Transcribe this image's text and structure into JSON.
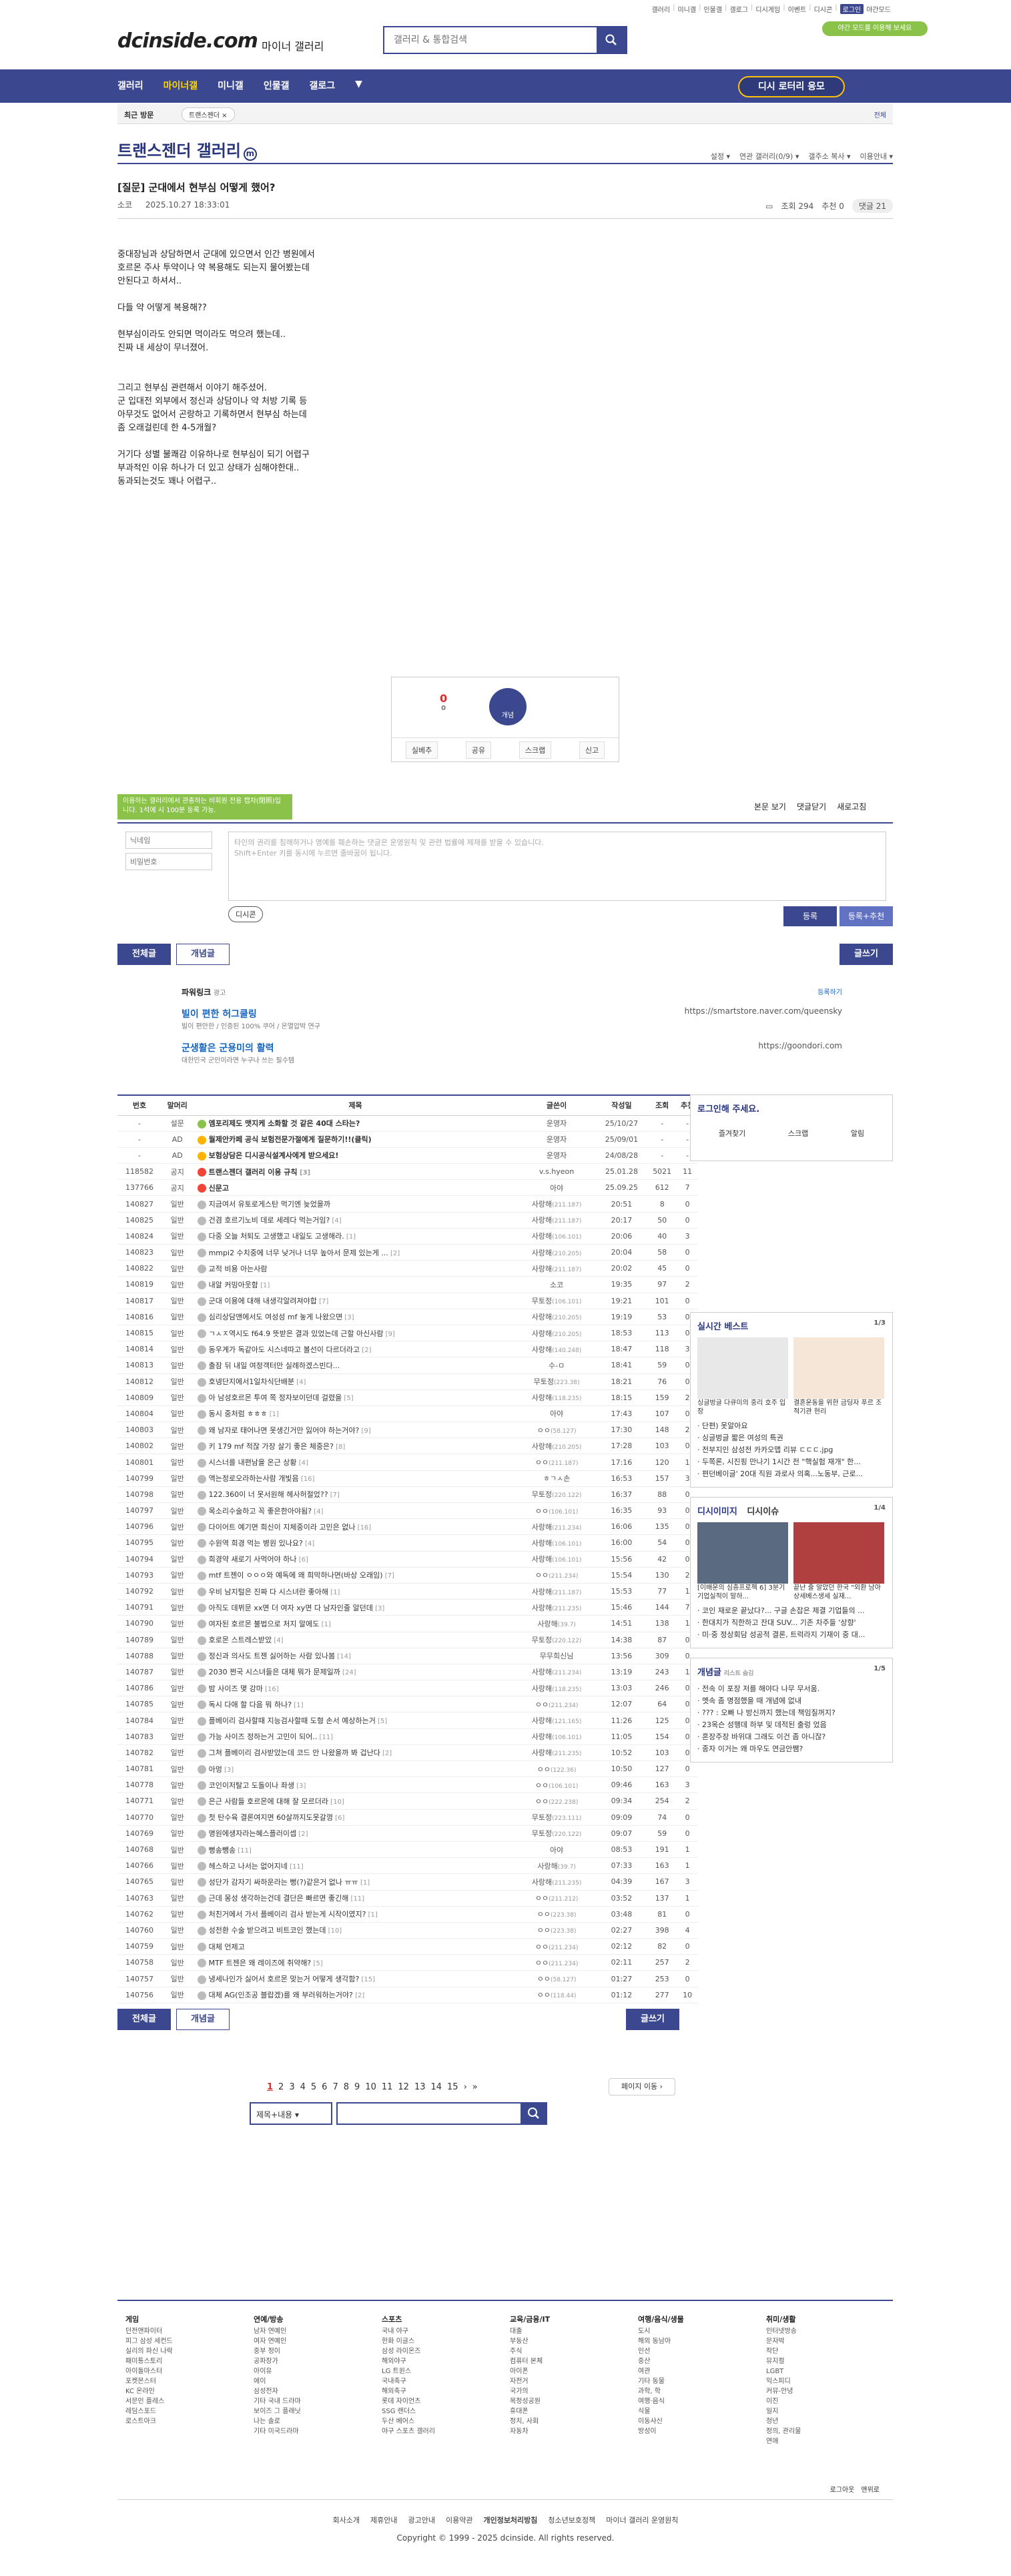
{
  "topbar": {
    "links": [
      "갤러리",
      "미니갤",
      "인물갤",
      "갤로그",
      "디시게임",
      "이벤트",
      "디시콘"
    ],
    "login": "로그인",
    "settings": "야간모드"
  },
  "header": {
    "logo": "dcinside.com",
    "logo_sub": "마이너 갤러리",
    "search_placeholder": "갤러리 & 통합검색",
    "darkmode": "야간 모드를 이용해 보세요"
  },
  "nav": {
    "items": [
      "갤러리",
      "마이너갤",
      "미니갤",
      "인물갤",
      "갤로그"
    ],
    "lotto": "디시 로터리 응모"
  },
  "visit": {
    "label": "최근 방문",
    "item": "트랜스젠더 ×",
    "edit": "전체"
  },
  "gallery": {
    "title": "트랜스젠더 갤러리",
    "opts": [
      "설정",
      "연관 갤러리(0/9)",
      "갤주소 복사",
      "이용안내"
    ]
  },
  "post": {
    "title": "[질문] 군대에서 현부심 어떻게 했어?",
    "author": "소코",
    "date": "2025.10.27 18:33:01",
    "views": "조회 294",
    "reco": "추천 0",
    "comments": "댓글 21",
    "body": [
      "중대장님과 상담하면서 군대에 있으면서 인간 병원에서",
      "호르몬 주사 투약이나 약 복용해도 되는지 물어봤는데",
      "안된다고 하셔서..",
      "",
      "다들 약 어떻게 복용해??",
      "",
      "현부심이라도 안되면 먹이라도 먹으려 했는데..",
      "진짜 내 세상이 무너졌어.",
      "",
      "",
      "그리고 현부심 관련해서 이야기 해주셨어.",
      "군 입대전 외부에서 정신과 상담이나 약 처방 기록 등",
      "아무것도 없어서 곤랑하고 기록하면서 현부심 하는데",
      "좀 오래걸린데 한 4-5개월?",
      "",
      "거기다 성별 불쾌감 이유하나로 현부심이 되기 어렵구",
      "부과적인 이유 하나가 더 있고 상태가 심해야한대..",
      "동과되는것도 꽤나 어렵구.."
    ]
  },
  "reco": {
    "up": "0",
    "sub": "0",
    "fix": "개념",
    "bar": [
      "실베추",
      "공유",
      "스크랩",
      "신고"
    ]
  },
  "comment": {
    "tip": "이용하는 갤러리에서 관종하는 비회원 전용 캡차(閉照)입니다. 1석에 시 100분 등록 가능.",
    "bar": [
      "본문 보기",
      "댓글닫기",
      "새로고침"
    ],
    "name_ph": "닉네임",
    "pw_ph": "비밀번호",
    "area": "타인의 권리를 침해하거나 명예를 훼손하는 댓글은 운영원칙 및 관련 법률에 제재를 받을 수 있습니다.",
    "area2": "Shift+Enter 키를 동시에 누르면 줄바꿈이 됩니다.",
    "dccon": "디시콘",
    "submit": "등록",
    "submit_reco": "등록+추천"
  },
  "buttons": {
    "all": "전체글",
    "best": "개념글",
    "write": "글쓰기"
  },
  "ads": {
    "label": "파워링크",
    "label2": "광고",
    "register": "등록하기",
    "items": [
      {
        "title": "빌이 편한 허그쿨링",
        "desc": "빌이 편안한 / 인증된 100% 쿠어 / 온열압박 연구",
        "url": "https://smartstore.naver.com/queensky"
      },
      {
        "title": "군생활은 군용미의 활력",
        "desc": "대한민국 군인이라면 누구나 쓰는 필수템",
        "url": "https://goondori.com"
      }
    ]
  },
  "list": {
    "headers": [
      "번호",
      "말머리",
      "제목",
      "글쓴이",
      "작성일",
      "조회",
      "추천"
    ],
    "rows": [
      [
        "-",
        "설문",
        "엠포리제도 맷지케 소화할 것 같은 40대 스타는?",
        "운영자",
        "25/10/27",
        "-",
        "-",
        "n",
        "a"
      ],
      [
        "-",
        "AD",
        "월제안카페 공식 보험전문가절에게 질문하기!!(클릭)",
        "운영자",
        "25/09/01",
        "-",
        "-",
        "n",
        "d"
      ],
      [
        "-",
        "AD",
        "보험상담은 디시공식설계사에게 받으세요!",
        "운영자",
        "24/08/28",
        "-",
        "-",
        "n",
        "d"
      ],
      [
        "118582",
        "공지",
        "트랜스젠더 갤러리 이용 규칙 [3]",
        "v.s.hyeon",
        "25.01.28",
        "5021",
        "11",
        "n",
        "c"
      ],
      [
        "137766",
        "공지",
        "신문고",
        "아야",
        "25.09.25",
        "612",
        "7",
        "n",
        "c"
      ],
      [
        "140827",
        "일반",
        "지금여서 유토로게스탄 먹기엔 늦었을까",
        "사랑해(211.187)",
        "20:51",
        "8",
        "0",
        "",
        ""
      ],
      [
        "140825",
        "일반",
        "건겸 호르기노비 데로 세레다 먹는거임? [4]",
        "사랑해(211.187)",
        "20:17",
        "50",
        "0",
        "",
        ""
      ],
      [
        "140824",
        "일반",
        "다중 오늘 처퇴도 고생했고 내일도 고생해라. [1]",
        "사랑해(106.101)",
        "20:06",
        "40",
        "3",
        "",
        ""
      ],
      [
        "140823",
        "일반",
        "mmpi2 수치중에 너무 낮거나 너무 높아서 문제 있는게 ... [2]",
        "사랑해(210.205)",
        "20:04",
        "58",
        "0",
        "",
        ""
      ],
      [
        "140822",
        "일반",
        "교적 비용 아는사람",
        "사랑해(211.187)",
        "20:02",
        "45",
        "0",
        "",
        ""
      ],
      [
        "140819",
        "일반",
        "내알 커밍아웃함 [1]",
        "소코",
        "19:35",
        "97",
        "2",
        "",
        ""
      ],
      [
        "140817",
        "일반",
        "군대 이용에 대해 내생각알려져야합 [7]",
        "무토정(106.101)",
        "19:21",
        "101",
        "0",
        "",
        ""
      ],
      [
        "140816",
        "일반",
        "심리상담앤에서도 여성성 mf 놓게 나왔으면 [3]",
        "사랑해(210.205)",
        "19:19",
        "53",
        "0",
        "",
        ""
      ],
      [
        "140815",
        "일반",
        "ㄱㅅㅈ역시도 f64.9 뜻받은 결과 있었는데 근할 아신사람 [9]",
        "사랑해(210.205)",
        "18:53",
        "113",
        "0",
        "",
        ""
      ],
      [
        "140814",
        "일반",
        "동우계가 독같아도 시스네따고 볼선이 다르더라고 [2]",
        "사랑해(140.248)",
        "18:47",
        "118",
        "3",
        "",
        ""
      ],
      [
        "140813",
        "일반",
        "출잠 뒤 내일 여정객터만 실례하겠스빈다...",
        "수-ㅁ",
        "18:41",
        "59",
        "0",
        "",
        ""
      ],
      [
        "140812",
        "일반",
        "호넹단지에서1일차식단배분 [4]",
        "무토정(223.38)",
        "18:21",
        "76",
        "0",
        "",
        ""
      ],
      [
        "140809",
        "일반",
        "아 남성호르몬 투여 쪽 정자보이던데 걸렸을 [5]",
        "사랑해(118.235)",
        "18:15",
        "159",
        "2",
        "",
        ""
      ],
      [
        "140804",
        "일반",
        "동시 중처럼 ㅎㅎㅎ [1]",
        "아야",
        "17:43",
        "107",
        "0",
        "",
        ""
      ],
      [
        "140803",
        "일반",
        "왜 남자로 태어나면 못생긴거만 잃어야 하는거야? [9]",
        "ㅇㅇ(58.127)",
        "17:30",
        "148",
        "2",
        "",
        ""
      ],
      [
        "140802",
        "일반",
        "키 179 mf 적잖 가장 살기 좋은 체중은? [8]",
        "사랑해(210.205)",
        "17:28",
        "103",
        "0",
        "",
        ""
      ],
      [
        "140801",
        "일반",
        "시스너를 내편남을 온근 상황 [4]",
        "ㅇㅇ(211.187)",
        "17:16",
        "120",
        "1",
        "",
        ""
      ],
      [
        "140799",
        "일반",
        "액는정로오라하는사람 개빛음 [16]",
        "ㅎㄱㅅ손",
        "16:53",
        "157",
        "3",
        "",
        ""
      ],
      [
        "140798",
        "일반",
        "122.360이 너 못서원해 헤사허절었?? [7]",
        "무토정(220.122)",
        "16:37",
        "88",
        "0",
        "",
        ""
      ],
      [
        "140797",
        "일반",
        "목소리수술하고 꼭 좋은한아야됨? [4]",
        "ㅇㅇ(106.101)",
        "16:35",
        "93",
        "0",
        "",
        ""
      ],
      [
        "140796",
        "일반",
        "다이어트 예기면 희신이 지체중이라 고민은 없나 [16]",
        "사랑해(211.234)",
        "16:06",
        "135",
        "0",
        "",
        ""
      ],
      [
        "140795",
        "일반",
        "수원역 희경 먹는 병원 있나요? [4]",
        "사랑해(106.101)",
        "16:00",
        "54",
        "0",
        "",
        ""
      ],
      [
        "140794",
        "일반",
        "희경약 새로기 사먹어야 하나 [6]",
        "사랑해(106.101)",
        "15:56",
        "42",
        "0",
        "",
        ""
      ],
      [
        "140793",
        "일반",
        "mtf 트젠이 ㅇㅇㅇ와 예독에 왜 희막하나면(바상 오래임) [7]",
        "ㅇㅇ(211.234)",
        "15:54",
        "130",
        "2",
        "",
        ""
      ],
      [
        "140792",
        "일반",
        "우비 남지털은 진짜 다 시스녀란 좋아해 [1]",
        "사랑해(211.187)",
        "15:53",
        "77",
        "1",
        "",
        ""
      ],
      [
        "140791",
        "일반",
        "아직도 데뷔문 xx면 더 여자 xy면 다 남자인줄 알던데 [3]",
        "사랑해(211.235)",
        "15:46",
        "144",
        "7",
        "",
        ""
      ],
      [
        "140790",
        "일반",
        "여자된 호르몬 불법으로 처지 말에도 [1]",
        "사랑해(39.7)",
        "14:51",
        "138",
        "1",
        "",
        ""
      ],
      [
        "140789",
        "일반",
        "호로몬 스트레스받았 [4]",
        "무토정(220.122)",
        "14:38",
        "87",
        "0",
        "",
        ""
      ],
      [
        "140788",
        "일반",
        "정신과 의사도 트젠 싫어하는 사람 있나봄 [14]",
        "무무희신님",
        "13:56",
        "309",
        "0",
        "",
        ""
      ],
      [
        "140787",
        "일반",
        "2030 쩐국 시스녀들은 대체 뭐가 문제일까 [24]",
        "사랑해(211.234)",
        "13:19",
        "243",
        "1",
        "",
        ""
      ],
      [
        "140786",
        "일반",
        "밤 사이즈 몇 강마 [16]",
        "사랑해(118.235)",
        "13:03",
        "246",
        "0",
        "",
        ""
      ],
      [
        "140785",
        "일반",
        "독시 다애 할 다음 뭐 하나? [1]",
        "ㅇㅇ(211.234)",
        "12:07",
        "64",
        "0",
        "",
        ""
      ],
      [
        "140784",
        "일반",
        "플베이리 검사할때 지능검사할때 도형 손서 예상하는거 [5]",
        "사랑해(121.165)",
        "11:26",
        "125",
        "0",
        "",
        ""
      ],
      [
        "140783",
        "일반",
        "가능 사이즈 정하는거 고민이 되어.. [11]",
        "사랑해(106.101)",
        "11:05",
        "154",
        "0",
        "",
        ""
      ],
      [
        "140782",
        "일반",
        "그쳐 플베이리 검사받았는데 코드 안 나왔을까 봐 겁난다 [2]",
        "사랑해(211.235)",
        "10:52",
        "103",
        "0",
        "",
        ""
      ],
      [
        "140781",
        "일반",
        "아멍 [3]",
        "ㅇㅇ(122.36)",
        "10:50",
        "127",
        "0",
        "",
        ""
      ],
      [
        "140778",
        "일반",
        "코인이저탈고 도돌이나 좌생 [3]",
        "ㅇㅇ(106.101)",
        "09:46",
        "163",
        "3",
        "",
        ""
      ],
      [
        "140771",
        "일반",
        "은근 사람들 호르몬에 대해 잘 모르더라 [10]",
        "ㅇㅇ(222.238)",
        "09:34",
        "254",
        "2",
        "",
        ""
      ],
      [
        "140770",
        "일반",
        "첫 탄수육 결론여지면 60살까지도못갈껑 [6]",
        "무토정(223.111)",
        "09:09",
        "74",
        "0",
        "",
        ""
      ],
      [
        "140769",
        "일반",
        "명원에생자라는혜스플러이셉 [2]",
        "무토정(220.122)",
        "09:07",
        "59",
        "0",
        "",
        ""
      ],
      [
        "140768",
        "일반",
        "뻥송뺑송 [11]",
        "아야",
        "08:53",
        "191",
        "1",
        "",
        ""
      ],
      [
        "140766",
        "일반",
        "헤스하고 나서는 없어지네 [11]",
        "사랑해(39.7)",
        "07:33",
        "163",
        "1",
        "",
        ""
      ],
      [
        "140765",
        "일반",
        "성단가 감자기 싸하운라는 뻥(?)같은거 없나 ㅠㅠ [1]",
        "사랑해(211.235)",
        "04:39",
        "167",
        "3",
        "",
        ""
      ],
      [
        "140763",
        "일반",
        "근데 몽성 생각하는건데 결단은 빠르면 좋긴해 [11]",
        "ㅇㅇ(211.212)",
        "03:52",
        "137",
        "1",
        "",
        ""
      ],
      [
        "140762",
        "일반",
        "처친거에서 가서 플베이리 검사 받는게 시작이였지? [1]",
        "ㅇㅇ(223.38)",
        "03:48",
        "81",
        "0",
        "",
        ""
      ],
      [
        "140760",
        "일반",
        "성전환 수술 받으려고 비트코인 했는데 [10]",
        "ㅇㅇ(223.38)",
        "02:27",
        "398",
        "4",
        "",
        ""
      ],
      [
        "140759",
        "일반",
        "대체 언제고",
        "ㅇㅇ(211.234)",
        "02:12",
        "82",
        "0",
        "",
        ""
      ],
      [
        "140758",
        "일반",
        "MTF 트젠은 왜 레이즈에 취약해? [5]",
        "ㅇㅇ(211.234)",
        "02:11",
        "257",
        "2",
        "",
        ""
      ],
      [
        "140757",
        "일반",
        "냉세나인가 싫어서 호르몬 맞는거 어떻게 생각함? [15]",
        "ㅇㅇ(58.127)",
        "01:27",
        "253",
        "0",
        "",
        ""
      ],
      [
        "140756",
        "일반",
        "대체 AG(인조공 블랍겠)를 왜 부러워하는거야? [2]",
        "ㅇㅇ(118.44)",
        "01:12",
        "277",
        "10",
        "",
        ""
      ]
    ]
  },
  "side": {
    "login": "로그인해 주세요.",
    "login_btns": [
      "즐겨찾기",
      "스크랩",
      "알림"
    ],
    "best_title": "실시간 베스트",
    "best_page": "1/3",
    "best_caps": [
      "싱글벙글 다큐미의 중리 호주 입장",
      "결혼운동을 위한 금딩자 푸르 조적기관 현리"
    ],
    "best_list": [
      "단편) 못알아요",
      "싱글벙글 짧은 여성의 특권",
      "전부지인 삼성전 카카오맵 리뷰 ㄷㄷㄷ.jpg",
      "두쪽론, 시진핑 만나기 1시간 전 \"핵실험 재개\" 한...",
      "편던베이글' 20대 직원 과로사 의혹...노동부, 근로..."
    ],
    "issue_title": "디시이미지",
    "issue_sub": "디시이슈",
    "issue_page": "1/4",
    "issue_caps": [
      "[이배운의 심층프로젝 6] 3분기 기업실적이 말하...",
      "끝난 줄 알았던 한국 \"외환 남아 상세베스생세 실재..."
    ],
    "issue_list": [
      "코인 재로운 끝났다?... 구글 손잡은 제결 기업들의 ...",
      "한대치가 직한하고 잔대 SUV... 기존 차주들 '상향'",
      "미·중 정상회담 성공적 결론, 트럭라지 기재이 중 대..."
    ],
    "concept_title": "개념글",
    "concept_sub": "리스트 숨김",
    "concept_page": "1/5",
    "concept_list": [
      "전속 이 포장 저를 해야다 나무 무서움.",
      "멧속 좀 명점했을 때 개념에 없내",
      "??? : 오빠 나 방신까지 했는데 책임질꺼지?",
      "23옥슨 성행데 하부 및 데적된 출렁 었음",
      "혼장주장 바위대 그래도 이건 좀 아니잖?",
      "종자 이거는 왜 마우도 연금안쨈?"
    ]
  },
  "pager": {
    "pages": [
      "1",
      "2",
      "3",
      "4",
      "5",
      "6",
      "7",
      "8",
      "9",
      "10",
      "11",
      "12",
      "13",
      "14",
      "15"
    ],
    "jump": "페이지 이동"
  },
  "bsearch": {
    "select": "제목+내용"
  },
  "footer": {
    "cols": [
      {
        "title": "게임",
        "items": [
          "던전앤파이터",
          "피그 삼성 세컨드",
          "실리의 파신 나락",
          "패미통스토리",
          "아이돌마스터",
          "포켓몬스터",
          "KC 온라인",
          "서문인 플레스",
          "레딤스포드",
          "로스트아크"
        ]
      },
      {
        "title": "연예/방송",
        "items": [
          "남자 연예인",
          "여자 연예인",
          "중부 정이",
          "공파장가",
          "아이유",
          "에이",
          "삼성전자",
          "기타 국내 드라마",
          "보이즈 그 플래닛",
          "나는 솔로",
          "기타 미국드라마"
        ]
      },
      {
        "title": "스포츠",
        "items": [
          "국내 야구",
          "한화 이글스",
          "삼성 라이온즈",
          "해외야구",
          "LG 트윈스",
          "국내축구",
          "해외축구",
          "롯데 자이언츠",
          "SSG 랜더스",
          "두산 베어스",
          "야구 스포츠 갤러리"
        ]
      },
      {
        "title": "교육/금융/IT",
        "items": [
          "대출",
          "부동산",
          "주식",
          "컴퓨터 본체",
          "아이폰",
          "자전거",
          "국가의",
          "목정성공원",
          "휴대폰",
          "정치, 사회",
          "자동차"
        ]
      },
      {
        "title": "여행/음식/생물",
        "items": [
          "도시",
          "해외 동남아",
          "인선",
          "중산",
          "여관",
          "기타 동물",
          "과학, 학",
          "여행·음식",
          "식물",
          "이동사신",
          "방성이"
        ]
      },
      {
        "title": "취미/생활",
        "items": [
          "인터넷방송",
          "문자박",
          "작단",
          "뮤지컬",
          "LGBT",
          "익스피디",
          "커뮤-안녕",
          "이진",
          "일지",
          "청년",
          "정의, 관리물",
          "연애"
        ]
      }
    ],
    "logout": "로그아웃",
    "top": "맨위로",
    "links": [
      "회사소개",
      "제휴안내",
      "광고안내",
      "이용약관",
      "개인정보처리방침",
      "청소년보호정책",
      "마이너 갤러리 운영원칙"
    ],
    "copyright": "Copyright © 1999 - 2025 dcinside. All rights reserved."
  }
}
